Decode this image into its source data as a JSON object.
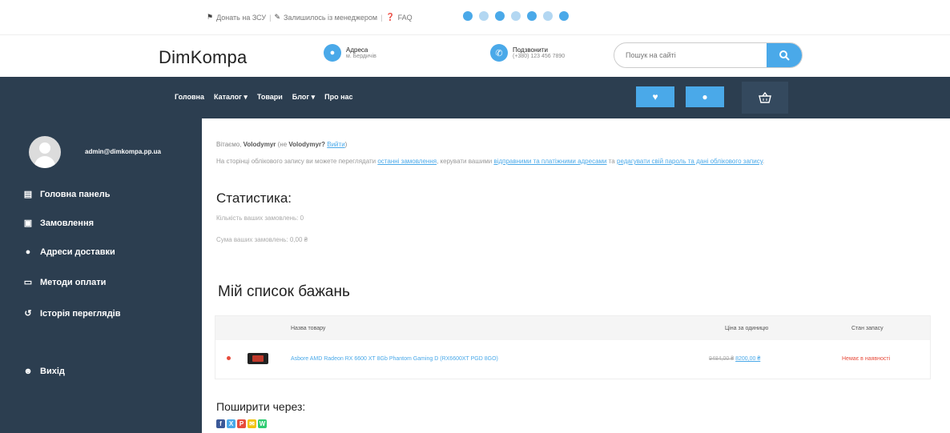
{
  "topbar": {
    "links": [
      "Донать на ЗСУ",
      "Залишилось із менеджером",
      "FAQ"
    ],
    "socials": [
      {
        "icon": "telegram-icon",
        "color": "#4aa9e9"
      },
      {
        "icon": "viber-icon",
        "color": "#b3d7f2"
      },
      {
        "icon": "facebook-icon",
        "color": "#4aa9e9"
      },
      {
        "icon": "instagram-icon",
        "color": "#b3d7f2"
      },
      {
        "icon": "twitter-icon",
        "color": "#4aa9e9"
      },
      {
        "icon": "youtube-icon",
        "color": "#b3d7f2"
      },
      {
        "icon": "skype-icon",
        "color": "#4aa9e9"
      }
    ]
  },
  "header": {
    "logo": "DimKompa",
    "address_title": "Адреса",
    "address_sub": "м. Бердичів",
    "phone_title": "Подзвонити",
    "phone_sub": "(+380) 123 456 7890",
    "search_placeholder": "Пошук на сайті"
  },
  "nav": {
    "items": [
      "Головна",
      "Каталог ▾",
      "Товари",
      "Блог ▾",
      "Про нас"
    ]
  },
  "sidebar": {
    "email": "admin@dimkompa.pp.ua",
    "items": [
      {
        "label": "Головна панель",
        "icon": "dashboard-icon"
      },
      {
        "label": "Замовлення",
        "icon": "orders-icon"
      },
      {
        "label": "Адреси доставки",
        "icon": "location-icon"
      },
      {
        "label": "Методи оплати",
        "icon": "credit-card-icon"
      },
      {
        "label": "Історія переглядів",
        "icon": "history-icon"
      },
      {
        "label": "Вихід",
        "icon": "logout-icon"
      }
    ]
  },
  "main": {
    "greet_prefix": "Вітаємо,",
    "greet_user": "Volodymyr",
    "greet_mid": "(не",
    "greet_user2": "Volodymyr?",
    "greet_logout": "Вийти",
    "greet_end": ")",
    "intro_a": "На сторінці облікового запису ви можете переглядати",
    "intro_link1": "останні замовлення",
    "intro_b": ", керувати вашими",
    "intro_link2": "відправними та платіжними адресами",
    "intro_c": "та",
    "intro_link3": "редагувати свій пароль та дані облікового запису",
    "intro_end": ".",
    "stats_title": "Статистика:",
    "stat_count": "Кількість ваших замовлень: 0",
    "stat_sum": "Сума ваших замовлень: 0,00 ₴",
    "wishlist_title": "Мій список бажань",
    "table": {
      "headers": [
        "Назва товару",
        "Ціна за одиницю",
        "Стан запасу"
      ],
      "rows": [
        {
          "name": "Asbore AMD Radeon RX 6600 XT 8Gb Phantom Gaming D (RX6600XT PGD 8GO)",
          "old_price": "9484,00 ₴",
          "new_price": "8200,00 ₴",
          "stock": "Немає в наявності"
        }
      ]
    },
    "share_title": "Поширити через:",
    "share_buttons": [
      {
        "label": "f",
        "color": "#3b5998",
        "icon": "facebook-icon"
      },
      {
        "label": "X",
        "color": "#4aa9e9",
        "icon": "twitter-icon"
      },
      {
        "label": "P",
        "color": "#e74c3c",
        "icon": "pinterest-icon"
      },
      {
        "label": "✉",
        "color": "#f1c40f",
        "icon": "email-icon"
      },
      {
        "label": "W",
        "color": "#2ecc71",
        "icon": "whatsapp-icon"
      }
    ]
  }
}
